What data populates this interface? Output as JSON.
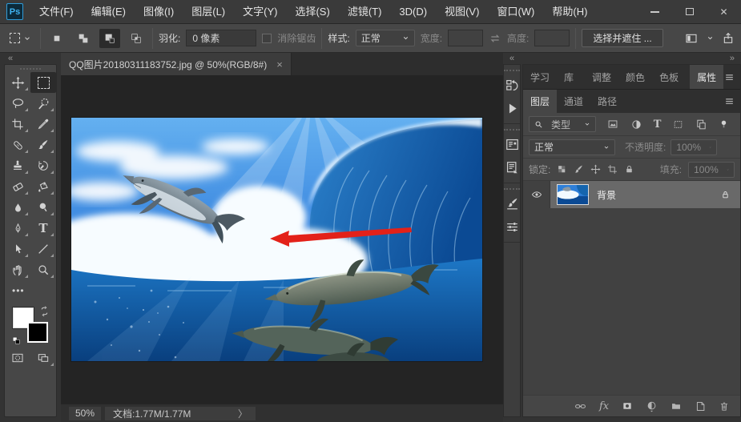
{
  "titlebar": {
    "logo": "Ps",
    "menus": [
      "文件(F)",
      "编辑(E)",
      "图像(I)",
      "图层(L)",
      "文字(Y)",
      "选择(S)",
      "滤镜(T)",
      "3D(D)",
      "视图(V)",
      "窗口(W)",
      "帮助(H)"
    ],
    "close_glyph": "✕"
  },
  "options_bar": {
    "feather_label": "羽化:",
    "feather_value": "0 像素",
    "antialias_label": "消除锯齿",
    "style_label": "样式:",
    "style_value": "正常",
    "width_label": "宽度:",
    "height_label": "高度:",
    "select_and_mask_label": "选择并遮住 ..."
  },
  "tool_glyphs": {
    "type_tool": "T",
    "ellipsis": "•••"
  },
  "document": {
    "tab_title": "QQ图片20180311183752.jpg @ 50%(RGB/8#)",
    "tab_close_glyph": "×",
    "status_zoom": "50%",
    "status_doc": "文档:1.77M/1.77M",
    "status_chevron": "〉"
  },
  "right_dock": {
    "collapse_left_glyph": "«",
    "collapse_right_glyph": "»",
    "top_tabs": [
      "学习",
      "库",
      "调整",
      "颜色",
      "色板",
      "属性"
    ],
    "middle_tabs": [
      "图层",
      "通道",
      "路径"
    ],
    "layers_panel": {
      "filter_placeholder": "类型",
      "blend_mode": "正常",
      "opacity_label": "不透明度:",
      "opacity_value": "100%",
      "lock_label": "锁定:",
      "fill_label": "填充:",
      "fill_value": "100%",
      "fx_glyph": "fx",
      "layers": [
        {
          "name": "背景"
        }
      ]
    }
  },
  "colors": {
    "accent_blue": "#31a8ff",
    "arrow_red": "#e32119",
    "selected_row": "#696969"
  }
}
